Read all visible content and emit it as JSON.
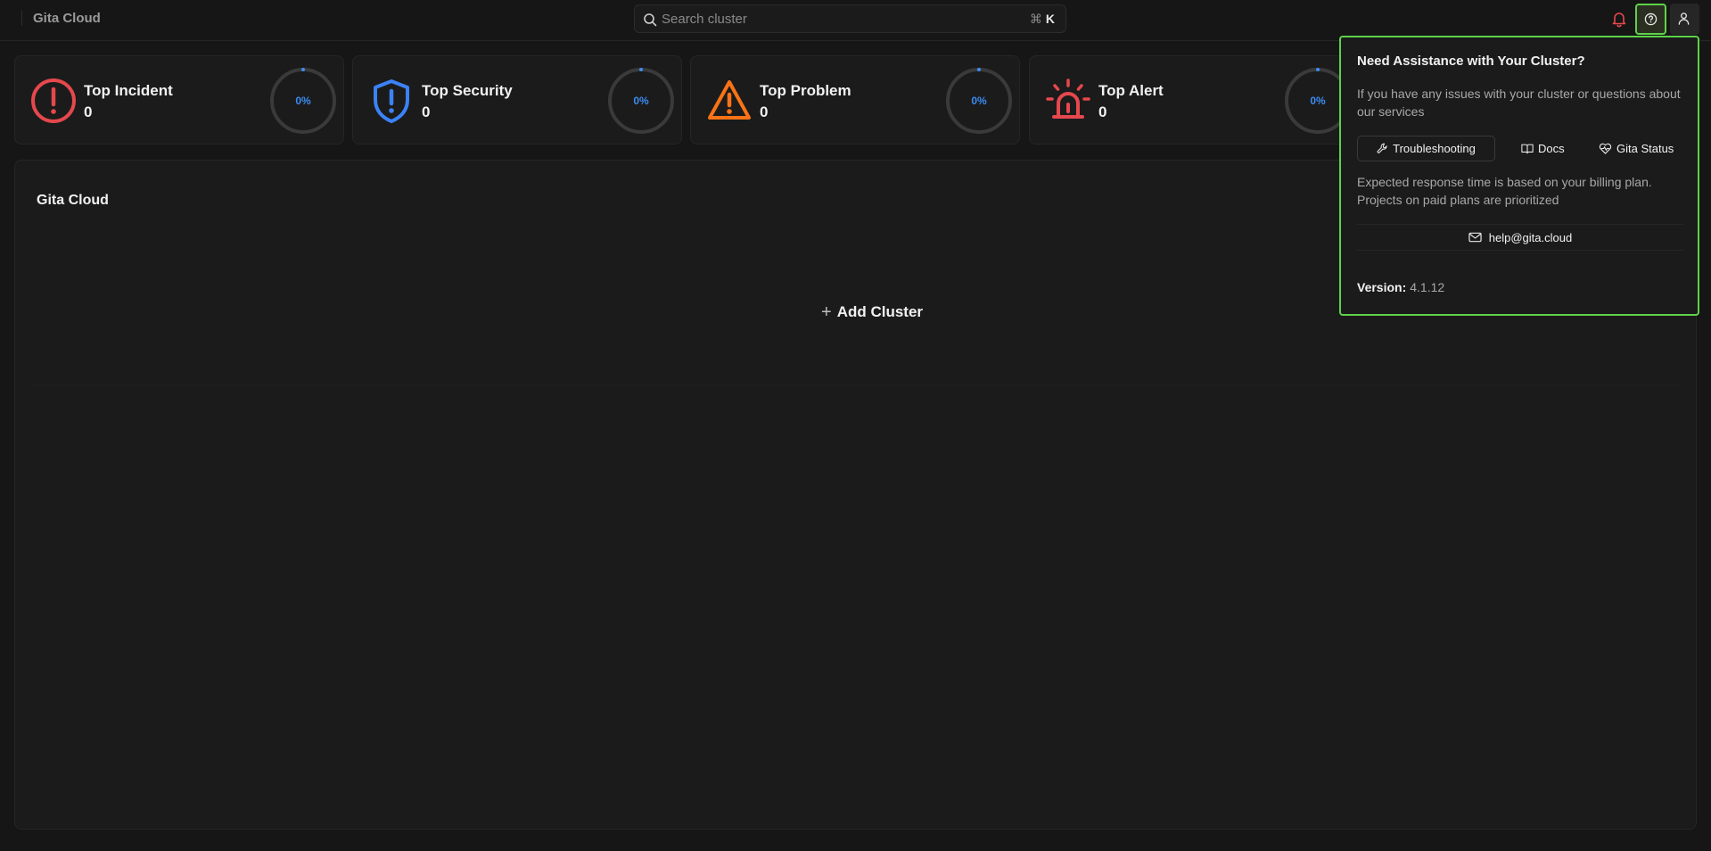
{
  "app": {
    "brand": "Gita Cloud"
  },
  "search": {
    "placeholder": "Search cluster",
    "shortcut_symbol": "⌘",
    "shortcut_key": "K"
  },
  "cards": [
    {
      "title": "Top Incident",
      "count": "0",
      "percent": "0%",
      "percent_value": 0,
      "color": "#e5484d",
      "icon": "alert-circle-icon"
    },
    {
      "title": "Top Security",
      "count": "0",
      "percent": "0%",
      "percent_value": 0,
      "color": "#3b82f6",
      "icon": "shield-alert-icon"
    },
    {
      "title": "Top Problem",
      "count": "0",
      "percent": "0%",
      "percent_value": 0,
      "color": "#f97316",
      "icon": "warning-triangle-icon"
    },
    {
      "title": "Top Alert",
      "count": "0",
      "percent": "0%",
      "percent_value": 0,
      "color": "#e5484d",
      "icon": "siren-icon"
    }
  ],
  "main": {
    "title": "Gita Cloud",
    "add_label": "Add Cluster"
  },
  "help": {
    "title": "Need Assistance with Your Cluster?",
    "description": "If you have any issues with your cluster or questions about our services",
    "links": [
      {
        "label": "Troubleshooting",
        "icon": "wrench-icon"
      },
      {
        "label": "Docs",
        "icon": "book-icon"
      },
      {
        "label": "Gita Status",
        "icon": "heart-pulse-icon"
      }
    ],
    "response": "Expected response time is based on your billing plan. Projects on paid plans are prioritized",
    "email": "help@gita.cloud",
    "version_label": "Version:",
    "version": "4.1.12"
  },
  "colors": {
    "accent": "#5ed14a",
    "ring": "#3b8cf0",
    "bell": "#e5484d"
  }
}
